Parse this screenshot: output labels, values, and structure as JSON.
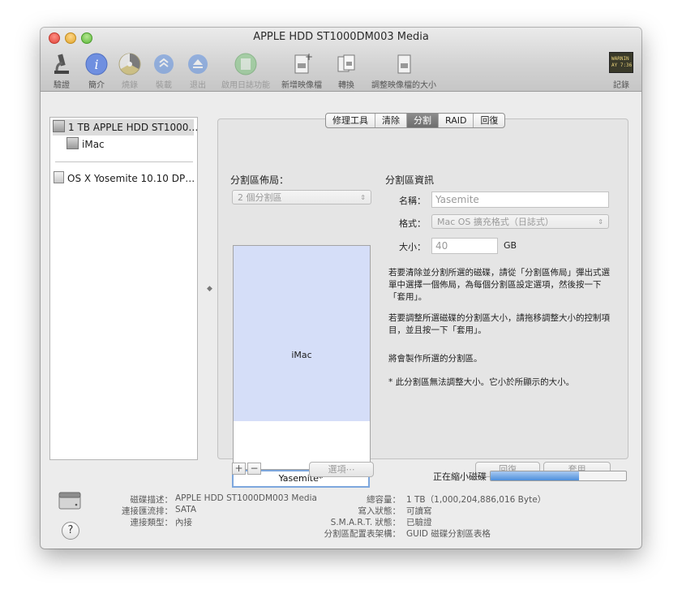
{
  "window": {
    "title": "APPLE HDD ST1000DM003 Media"
  },
  "toolbar": {
    "verify": "驗證",
    "info": "簡介",
    "burn": "燒錄",
    "mount": "裝載",
    "eject": "退出",
    "enable_journaling": "啟用日誌功能",
    "new_image": "新增映像檔",
    "convert": "轉換",
    "resize_image": "調整映像檔的大小",
    "log": "記錄",
    "log_icon_text": "WARNIN\nAY 7:36"
  },
  "sidebar": {
    "items": [
      {
        "label": "1 TB APPLE HDD ST1000…"
      },
      {
        "label": "iMac"
      },
      {
        "label": "OS X Yosemite 10.10 DP…"
      }
    ]
  },
  "tabs": [
    "修理工具",
    "清除",
    "分割",
    "RAID",
    "回復"
  ],
  "layout_section": {
    "title": "分割區佈局：",
    "scheme_popup": "2 個分割區",
    "partitions": [
      "iMac",
      "Yasemite*"
    ],
    "add": "+",
    "remove": "−",
    "options_button": "選項⋯"
  },
  "info_section": {
    "title": "分割區資訊",
    "name_label": "名稱：",
    "name_value": "Yasemite",
    "format_label": "格式：",
    "format_value": "Mac OS 擴充格式（日誌式）",
    "size_label": "大小：",
    "size_value": "40",
    "size_unit": "GB",
    "para1": "若要清除並分割所選的磁碟，請從「分割區佈局」彈出式選單中選擇一個佈局，為每個分割區設定選項，然後按一下「套用」。",
    "para2": "若要調整所選磁碟的分割區大小，請拖移調整大小的控制項目，並且按一下「套用」。",
    "para3": "將會製作所選的分割區。",
    "para4": "* 此分割區無法調整大小。它小於所顯示的大小。",
    "revert_button": "回復",
    "apply_button": "套用"
  },
  "status": {
    "progress_label": "正在縮小磁碟",
    "progress": 0.65,
    "disk_desc_label": "磁碟描述：",
    "disk_desc": "APPLE HDD ST1000DM003 Media",
    "bus_label": "連接匯流排：",
    "bus": "SATA",
    "type_label": "連接類型：",
    "type": "內接",
    "capacity_label": "總容量：",
    "capacity": "1 TB（1,000,204,886,016 Byte）",
    "write_label": "寫入狀態：",
    "write": "可讀寫",
    "smart_label": "S.M.A.R.T. 狀態：",
    "smart": "已驗證",
    "scheme_label": "分割區配置表架構：",
    "scheme": "GUID 磁碟分割區表格",
    "help": "?"
  },
  "colors": {
    "partition_fill": "#d5def8",
    "selection": "#7da7dd",
    "progress": "#4d8fdc"
  }
}
